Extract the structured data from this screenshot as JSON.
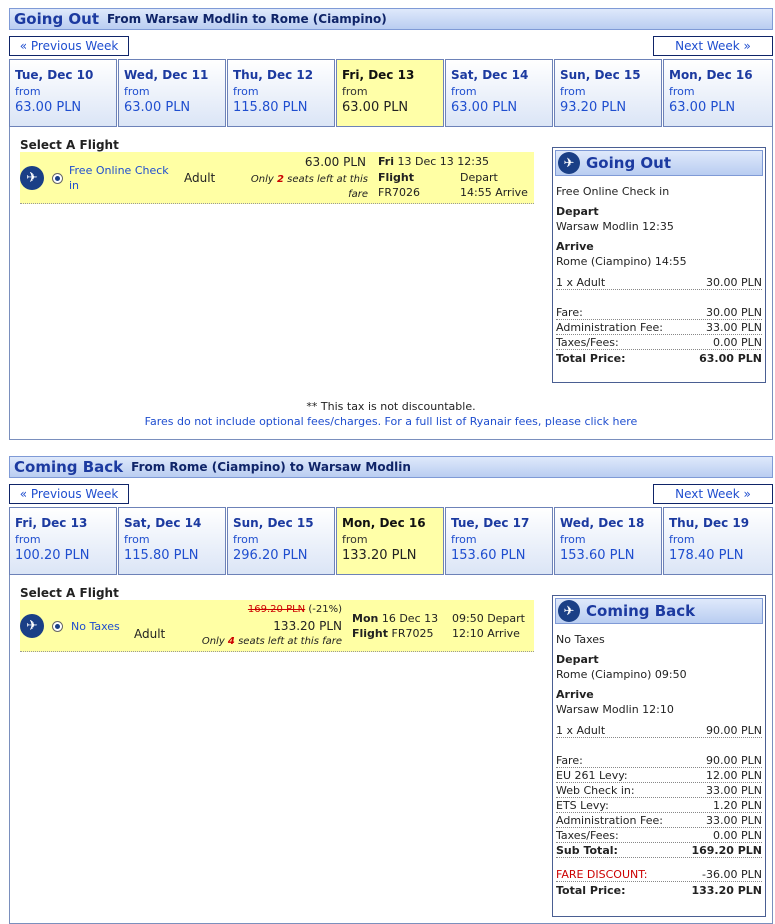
{
  "out": {
    "title": "Going Out",
    "route": "From Warsaw Modlin to Rome (Ciampino)",
    "prev_week": "« Previous Week",
    "next_week": "Next Week »",
    "days": [
      {
        "name": "Tue, Dec 10",
        "from": "from",
        "price": "63.00 PLN"
      },
      {
        "name": "Wed, Dec 11",
        "from": "from",
        "price": "63.00 PLN"
      },
      {
        "name": "Thu, Dec 12",
        "from": "from",
        "price": "115.80 PLN"
      },
      {
        "name": "Fri, Dec 13",
        "from": "from",
        "price": "63.00 PLN"
      },
      {
        "name": "Sat, Dec 14",
        "from": "from",
        "price": "63.00 PLN"
      },
      {
        "name": "Sun, Dec 15",
        "from": "from",
        "price": "93.20 PLN"
      },
      {
        "name": "Mon, Dec 16",
        "from": "from",
        "price": "63.00 PLN"
      }
    ],
    "select_label": "Select A Flight",
    "flight": {
      "fare_type": "Free Online Check in",
      "pax": "Adult",
      "price": "63.00 PLN",
      "seats_pre": "Only",
      "seats_num": "2",
      "seats_post": "seats left at this fare",
      "day": "Fri",
      "date": "13 Dec 13",
      "time_dep": "12:35",
      "flight_label": "Flight",
      "depart_label": "Depart",
      "flight_no": "FR7026",
      "arrive": "14:55 Arrive"
    },
    "note1": "** This tax is not discountable.",
    "note2": "Fares do not include optional fees/charges. For a full list of Ryanair fees, please click here",
    "summary": {
      "title": "Going Out",
      "fare_type": "Free Online Check in",
      "depart_label": "Depart",
      "depart": "Warsaw Modlin 12:35",
      "arrive_label": "Arrive",
      "arrive": "Rome (Ciampino) 14:55",
      "pax_label": "1 x Adult",
      "pax_val": "30.00 PLN",
      "fare_label": "Fare:",
      "fare_val": "30.00 PLN",
      "admin_label": "Administration Fee:",
      "admin_val": "33.00 PLN",
      "taxes_label": "Taxes/Fees:",
      "taxes_val": "0.00 PLN",
      "total_label": "Total Price:",
      "total_val": "63.00 PLN"
    }
  },
  "back": {
    "title": "Coming Back",
    "route": "From Rome (Ciampino) to Warsaw Modlin",
    "prev_week": "« Previous Week",
    "next_week": "Next Week »",
    "days": [
      {
        "name": "Fri, Dec 13",
        "from": "from",
        "price": "100.20 PLN"
      },
      {
        "name": "Sat, Dec 14",
        "from": "from",
        "price": "115.80 PLN"
      },
      {
        "name": "Sun, Dec 15",
        "from": "from",
        "price": "296.20 PLN"
      },
      {
        "name": "Mon, Dec 16",
        "from": "from",
        "price": "133.20 PLN"
      },
      {
        "name": "Tue, Dec 17",
        "from": "from",
        "price": "153.60 PLN"
      },
      {
        "name": "Wed, Dec 18",
        "from": "from",
        "price": "153.60 PLN"
      },
      {
        "name": "Thu, Dec 19",
        "from": "from",
        "price": "178.40 PLN"
      }
    ],
    "select_label": "Select A Flight",
    "flight": {
      "fare_type": "No Taxes",
      "pax": "Adult",
      "old_price": "169.20 PLN",
      "discount": "(-21%)",
      "price": "133.20 PLN",
      "seats_pre": "Only",
      "seats_num": "4",
      "seats_post": "seats left at this fare",
      "day": "Mon",
      "date": "16 Dec 13",
      "time_dep": "09:50 Depart",
      "flight_label": "Flight",
      "flight_no": "FR7025",
      "arrive": "12:10 Arrive"
    },
    "summary": {
      "title": "Coming Back",
      "fare_type": "No Taxes",
      "depart_label": "Depart",
      "depart": "Rome (Ciampino) 09:50",
      "arrive_label": "Arrive",
      "arrive": "Warsaw Modlin 12:10",
      "pax_label": "1 x Adult",
      "pax_val": "90.00 PLN",
      "fare_label": "Fare:",
      "fare_val": "90.00 PLN",
      "eu_label": "EU 261 Levy:",
      "eu_val": "12.00 PLN",
      "web_label": "Web Check in:",
      "web_val": "33.00 PLN",
      "ets_label": "ETS Levy:",
      "ets_val": "1.20 PLN",
      "admin_label": "Administration Fee:",
      "admin_val": "33.00 PLN",
      "taxes_label": "Taxes/Fees:",
      "taxes_val": "0.00 PLN",
      "sub_label": "Sub Total:",
      "sub_val": "169.20 PLN",
      "disc_label": "FARE DISCOUNT:",
      "disc_val": "-36.00 PLN",
      "total_label": "Total Price:",
      "total_val": "133.20 PLN"
    }
  }
}
